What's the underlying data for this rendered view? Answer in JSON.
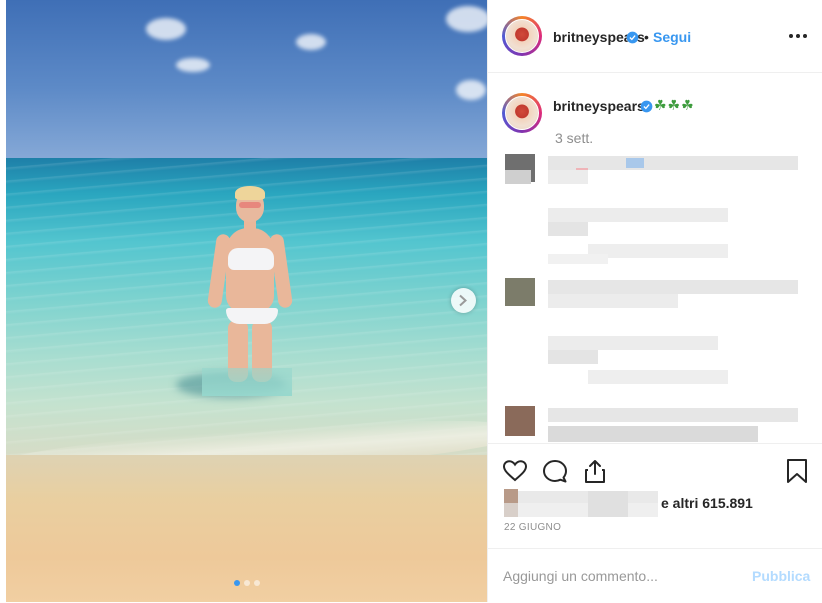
{
  "header": {
    "username": "britneyspears",
    "separator": "•",
    "follow_label": "Segui"
  },
  "caption": {
    "username": "britneyspears",
    "text": "☘☘☘",
    "time_ago": "3 sett."
  },
  "likes": {
    "text": "e altri 615.891"
  },
  "date": "22 GIUGNO",
  "comment_box": {
    "placeholder": "Aggiungi un commento...",
    "publish_label": "Pubblica"
  },
  "carousel": {
    "slide_count": 3,
    "active_slide": 1
  },
  "colors": {
    "accent": "#3897f0",
    "verified": "#3897f0",
    "publish_disabled": "#b3dbff",
    "muted_text": "#8e8e8e"
  },
  "icons": [
    "more-options-icon",
    "verified-badge-icon",
    "heart-icon",
    "comment-icon",
    "share-icon",
    "bookmark-icon",
    "chevron-right-icon"
  ]
}
